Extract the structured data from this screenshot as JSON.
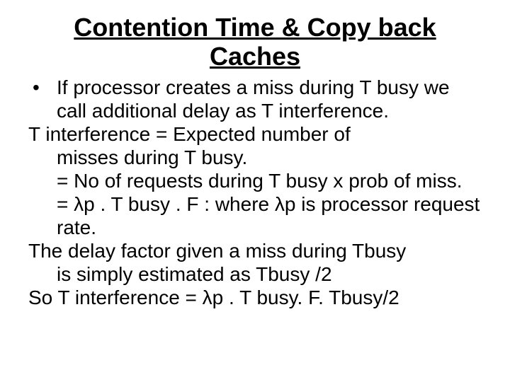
{
  "title": "Contention Time & Copy back Caches",
  "bullet": {
    "marker": "•",
    "text": "If processor creates a miss during T busy we call additional delay as T interference."
  },
  "lines": {
    "l1": "T interference = Expected number of",
    "l2": "misses during T busy.",
    "l3": "= No of requests during T busy x prob of miss.",
    "l4": "= λp . T busy . F :  where λp is processor request rate.",
    "l5": "The  delay factor given a miss during Tbusy",
    "l6": "is simply estimated as Tbusy /2",
    "l7": "So T interference = λp . T busy. F. Tbusy/2"
  }
}
